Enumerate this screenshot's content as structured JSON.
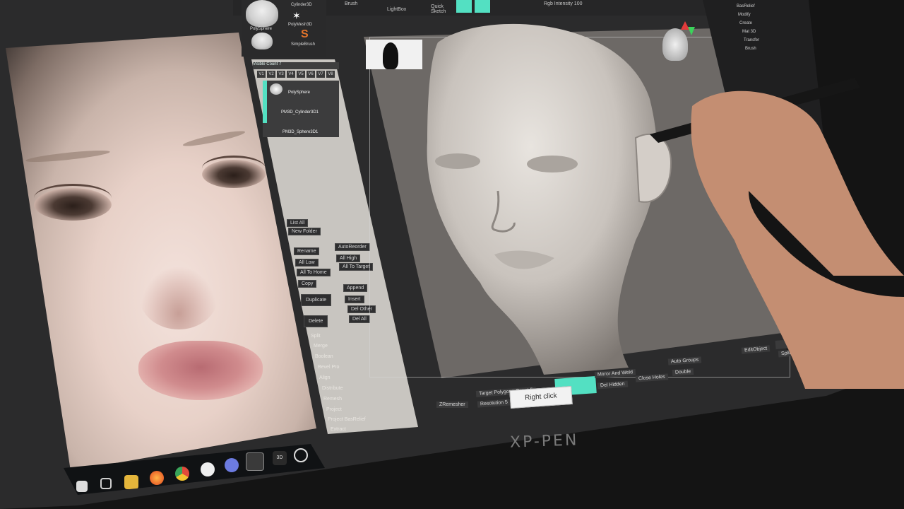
{
  "brand": "XP-PEN",
  "top_toolbar": {
    "brush_label": "Brush",
    "lightbox": "LightBox",
    "quick_sketch": "Quick Sketch",
    "rgb_intensity": "Rgb Intensity 100"
  },
  "tool_palette": {
    "items": [
      "Cylinder3D",
      "PolyMesh3D",
      "SimpleBrush",
      "PolySphere"
    ]
  },
  "subtool": {
    "header": "Visible Count 7",
    "version_tabs": [
      "V1",
      "V2",
      "V3",
      "V4",
      "V5",
      "V6",
      "V7",
      "V8"
    ],
    "items": [
      "PolySphere",
      "PM3D_Cylinder3D1",
      "PM3D_Sphere3D1"
    ],
    "buttons": {
      "list_all": "List All",
      "new_folder": "New Folder",
      "rename": "Rename",
      "auto_reorder": "AutoReorder",
      "all_low": "All Low",
      "all_high": "All High",
      "all_to_home": "All To Home",
      "all_to_target": "All To Target",
      "copy": "Copy",
      "duplicate": "Duplicate",
      "append": "Append",
      "insert": "Insert",
      "delete": "Delete",
      "del_other": "Del Other",
      "del_all": "Del All"
    },
    "menu": [
      "Split",
      "Merge",
      "Boolean",
      "Bevel Pro",
      "Align",
      "Distribute",
      "Remesh",
      "Project",
      "Project BasRelief",
      "Extract"
    ]
  },
  "viewport": {
    "bottom": {
      "zremesher": "ZRemesher",
      "target_polygons": "Target Polygons Count 5",
      "resolution": "Resolution 5",
      "mirror_and_weld": "Mirror And Weld",
      "del_hidden": "Del Hidden",
      "close_holes": "Close Holes",
      "double": "Double",
      "auto_groups": "Auto Groups",
      "edit_object": "EditObject",
      "split_unmasked": "Split Unmasked",
      "right_click_tooltip": "Right click"
    }
  },
  "right_panel": {
    "items": [
      "BasRelief",
      "Modify",
      "Create",
      "Mat 3D",
      "Transfer",
      "Brush"
    ]
  },
  "colors": {
    "accent": "#53e0c2",
    "viewport_bg": "#6d6966",
    "panel_bg": "#2b2b2c",
    "subtool_bg": "#c8c5c0"
  }
}
